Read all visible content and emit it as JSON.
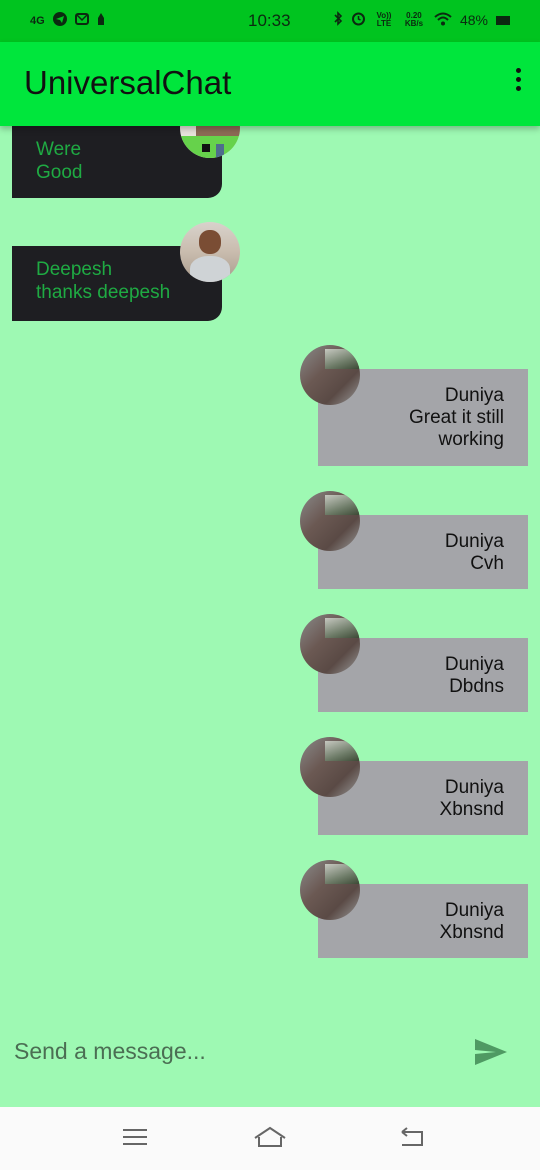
{
  "status_bar": {
    "network": "4G",
    "time": "10:33",
    "volte": "Vo)) LTE",
    "speed": "0.20 KB/s",
    "battery": "48%"
  },
  "app_bar": {
    "title": "UniversalChat",
    "menu_icon": "more-vert-icon"
  },
  "messages": [
    {
      "direction": "incoming",
      "sender": "Were",
      "text": "Good"
    },
    {
      "direction": "incoming",
      "sender": "Deepesh",
      "text": "thanks deepesh"
    },
    {
      "direction": "outgoing",
      "sender": "Duniya",
      "text_line1": "Great it still",
      "text_line2": "working"
    },
    {
      "direction": "outgoing",
      "sender": "Duniya",
      "text": "Cvh"
    },
    {
      "direction": "outgoing",
      "sender": "Duniya",
      "text": "Dbdns"
    },
    {
      "direction": "outgoing",
      "sender": "Duniya",
      "text": "Xbnsnd"
    },
    {
      "direction": "outgoing",
      "sender": "Duniya",
      "text": "Xbnsnd"
    }
  ],
  "composer": {
    "placeholder": "Send a message...",
    "send_icon": "send-icon"
  },
  "colors": {
    "background": "#9ef9b3",
    "app_bar": "#00e63c",
    "status_bar": "#00c41f",
    "incoming_bubble": "#1e1e22",
    "incoming_text": "#1faa43",
    "outgoing_bubble": "#a4a5a9",
    "send_icon": "#4f9a63"
  },
  "nav_bar": {
    "icons": [
      "menu-icon",
      "home-icon",
      "back-icon"
    ]
  }
}
